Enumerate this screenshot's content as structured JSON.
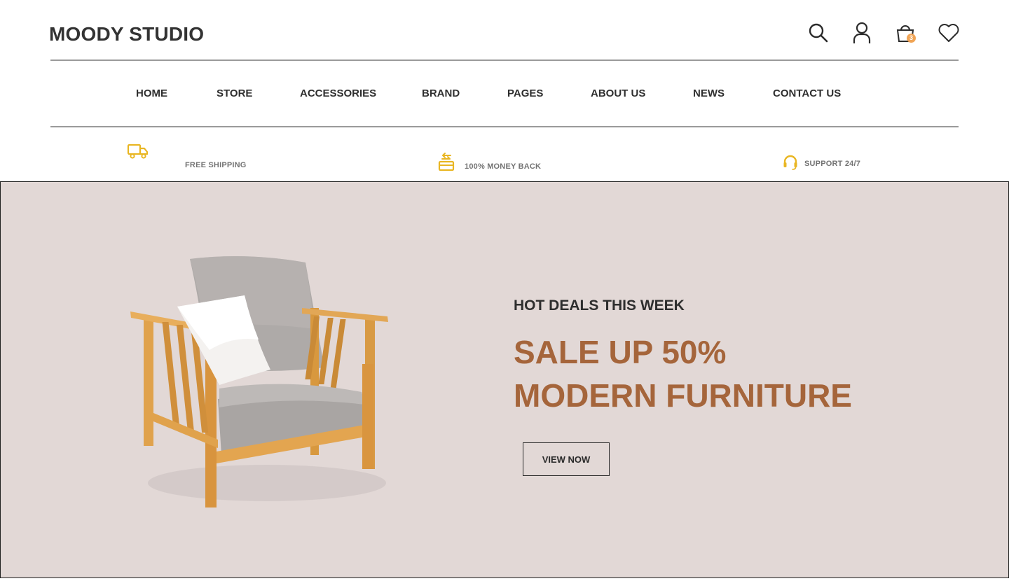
{
  "header": {
    "logo": "MOODY STUDIO",
    "icons": [
      "search-icon",
      "user-icon",
      "cart-icon",
      "heart-icon"
    ],
    "cart_count": "3"
  },
  "nav": {
    "items": [
      "HOME",
      "STORE",
      "ACCESSORIES",
      "BRAND",
      "PAGES",
      "ABOUT US",
      "NEWS",
      "CONTACT US"
    ]
  },
  "features": {
    "items": [
      {
        "icon": "truck-icon",
        "label": "FREE SHIPPING"
      },
      {
        "icon": "money-back-icon",
        "label": "100% MONEY BACK"
      },
      {
        "icon": "headset-icon",
        "label": "SUPPORT 24/7"
      }
    ]
  },
  "hero": {
    "kicker": "HOT DEALS THIS WEEK",
    "headline_line1": "SALE UP 50%",
    "headline_line2": "MODERN FURNITURE",
    "button": "VIEW NOW"
  },
  "colors": {
    "accent": "#a5653b",
    "feature_icon": "#e9b623",
    "badge": "#f0a455",
    "hero_bg": "#e2d8d6"
  }
}
